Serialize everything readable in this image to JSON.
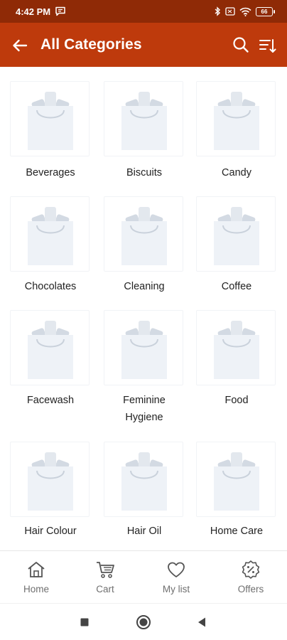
{
  "status_bar": {
    "time": "4:42 PM",
    "battery": "66",
    "icons": [
      "message-icon",
      "bluetooth-icon",
      "sim-icon",
      "wifi-icon",
      "battery-icon"
    ]
  },
  "app_bar": {
    "title": "All Categories",
    "icons": [
      "back-arrow-icon",
      "search-icon",
      "sort-icon"
    ]
  },
  "categories": [
    {
      "label": "Beverages"
    },
    {
      "label": "Biscuits"
    },
    {
      "label": "Candy"
    },
    {
      "label": "Chocolates"
    },
    {
      "label": "Cleaning"
    },
    {
      "label": "Coffee"
    },
    {
      "label": "Facewash"
    },
    {
      "label": "Feminine Hygiene",
      "line1": "Feminine",
      "line2": "Hygiene"
    },
    {
      "label": "Food"
    },
    {
      "label": "Hair Colour"
    },
    {
      "label": "Hair Oil"
    },
    {
      "label": "Home Care"
    }
  ],
  "bottom_nav": {
    "items": [
      {
        "label": "Home",
        "icon": "home-icon"
      },
      {
        "label": "Cart",
        "icon": "cart-icon"
      },
      {
        "label": "My list",
        "icon": "heart-icon"
      },
      {
        "label": "Offers",
        "icon": "offer-badge-icon"
      }
    ]
  },
  "system_nav": {
    "icons": [
      "recents-square-icon",
      "home-circle-icon",
      "back-triangle-icon"
    ]
  },
  "colors": {
    "status_bar": "#8f2a06",
    "app_bar": "#be3a0c",
    "placeholder_bag": "#eef2f7",
    "placeholder_items": "#d3dae3"
  }
}
